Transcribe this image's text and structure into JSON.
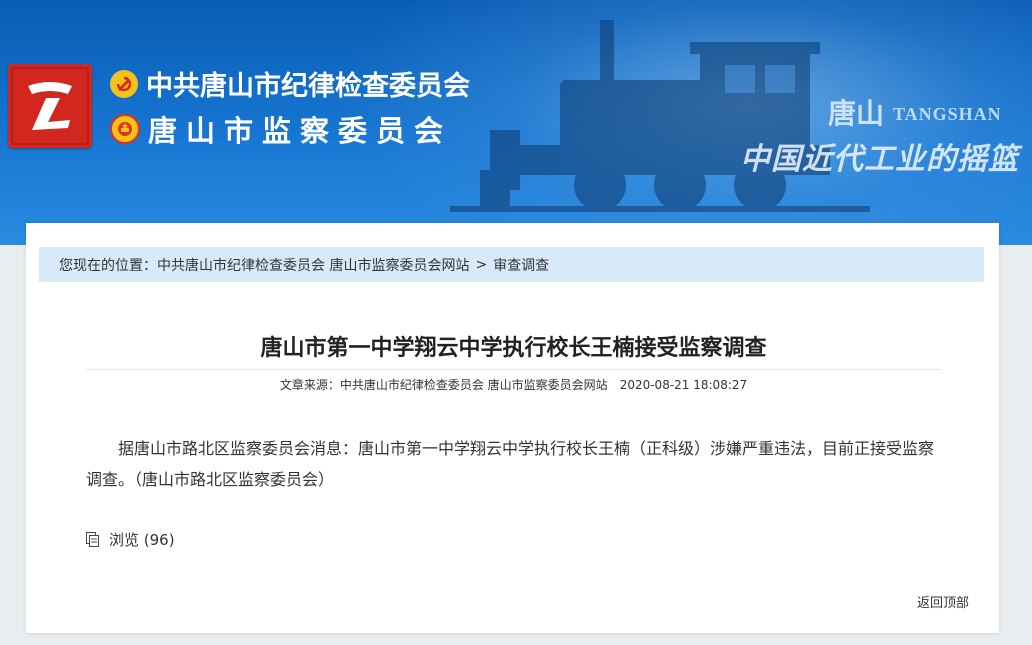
{
  "header": {
    "org_name_1": "中共唐山市纪律检查委员会",
    "org_name_2": "唐山市监察委员会",
    "logo_icon": "tangshan-red-logo-icon",
    "brand_city": "唐山",
    "brand_city_en": "TANGSHAN",
    "brand_slogan": "中国近代工业的摇篮",
    "colors": {
      "banner": "#1676d2",
      "logo": "#d1271f",
      "emblem": "#f4c21a"
    }
  },
  "breadcrumb": {
    "label": "您现在的位置：",
    "site": "中共唐山市纪律检查委员会 唐山市监察委员会网站",
    "separator": ">",
    "section": "审查调查"
  },
  "article": {
    "title": "唐山市第一中学翔云中学执行校长王楠接受监察调查",
    "source_label": "文章来源：",
    "source": "中共唐山市纪律检查委员会 唐山市监察委员会网站",
    "date": "2020-08-21 18:08:27",
    "body": "据唐山市路北区监察委员会消息：唐山市第一中学翔云中学执行校长王楠（正科级）涉嫌严重违法，目前正接受监察调查。（唐山市路北区监察委员会）"
  },
  "views": {
    "label": "浏览 (96)"
  },
  "footer": {
    "back_to_top": "返回顶部"
  }
}
